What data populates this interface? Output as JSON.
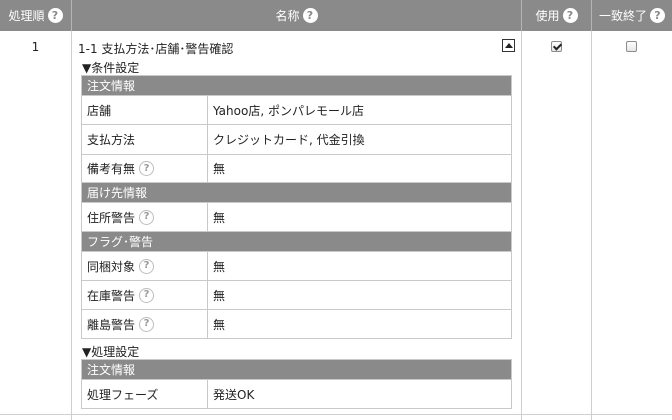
{
  "header": {
    "order": {
      "label": "処理順",
      "help_icon": "help-circle-icon"
    },
    "name": {
      "label": "名称",
      "help_icon": "help-circle-icon"
    },
    "use": {
      "label": "使用",
      "help_icon": "help-circle-icon"
    },
    "match_end": {
      "label": "一致終了",
      "help_icon": "help-circle-icon"
    }
  },
  "rule": {
    "order": "1",
    "name": "1-1 支払方法･店舗･警告確認",
    "collapse_icon": "collapse-up-icon",
    "use_checked": true,
    "match_end_checked": false
  },
  "conditions": {
    "title": "▼条件設定",
    "groups": [
      {
        "label": "注文情報",
        "rows": [
          {
            "key": "店舗",
            "value": "Yahoo店, ポンパレモール店",
            "help": false
          },
          {
            "key": "支払方法",
            "value": "クレジットカード, 代金引換",
            "help": false
          },
          {
            "key": "備考有無",
            "value": "無",
            "help": true
          }
        ]
      },
      {
        "label": "届け先情報",
        "rows": [
          {
            "key": "住所警告",
            "value": "無",
            "help": true
          }
        ]
      },
      {
        "label": "フラグ･警告",
        "rows": [
          {
            "key": "同梱対象",
            "value": "無",
            "help": true
          },
          {
            "key": "在庫警告",
            "value": "無",
            "help": true
          },
          {
            "key": "離島警告",
            "value": "無",
            "help": true
          }
        ]
      }
    ]
  },
  "processing": {
    "title": "▼処理設定",
    "groups": [
      {
        "label": "注文情報",
        "rows": [
          {
            "key": "処理フェーズ",
            "value": "発送OK",
            "help": false
          }
        ]
      }
    ]
  },
  "help_glyph": "?"
}
